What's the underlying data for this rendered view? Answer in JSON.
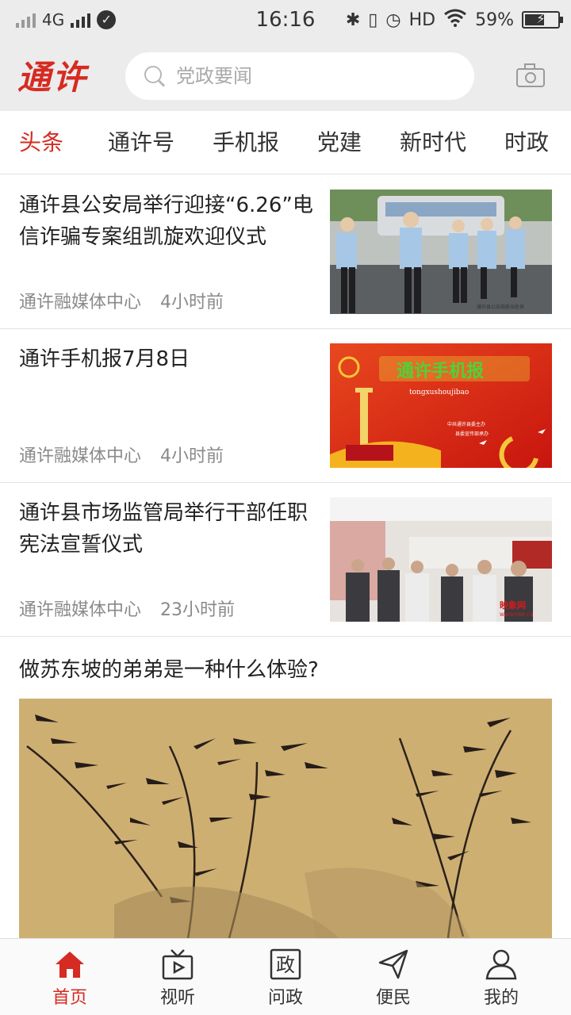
{
  "status_bar": {
    "network": "4G",
    "time": "16:16",
    "hd": "HD",
    "battery": "59%",
    "battery_level": 0.59
  },
  "header": {
    "logo": "通许",
    "search_placeholder": "党政要闻"
  },
  "tabs": [
    {
      "label": "头条",
      "active": true
    },
    {
      "label": "通许号",
      "active": false
    },
    {
      "label": "手机报",
      "active": false
    },
    {
      "label": "党建",
      "active": false
    },
    {
      "label": "新时代",
      "active": false
    },
    {
      "label": "时政",
      "active": false
    }
  ],
  "news": [
    {
      "title": "通许县公安局举行迎接“6.26”电信诈骗专案组凯旋欢迎仪式",
      "source": "通许融媒体中心",
      "time": "4小时前",
      "image_caption": "通许县公安局政治处供"
    },
    {
      "title": "通许手机报7月8日",
      "source": "通许融媒体中心",
      "time": "4小时前",
      "image_title": "通许手机报",
      "image_subtitle": "tongxushoujibao",
      "image_note_1": "中共通许县委主办",
      "image_note_2": "县委宣传部承办"
    },
    {
      "title": "通许县市场监管局举行干部任职宪法宣誓仪式",
      "source": "通许融媒体中心",
      "time": "23小时前",
      "image_watermark": "映象网",
      "image_watermark_url": "WWW.HNR.CN"
    }
  ],
  "feature": {
    "title": "做苏东坡的弟弟是一种什么体验?"
  },
  "bottom_nav": [
    {
      "label": "首页",
      "icon": "home-icon",
      "active": true
    },
    {
      "label": "视听",
      "icon": "tv-icon",
      "active": false
    },
    {
      "label": "问政",
      "icon": "zheng-icon",
      "glyph": "政",
      "active": false
    },
    {
      "label": "便民",
      "icon": "paper-plane-icon",
      "active": false
    },
    {
      "label": "我的",
      "icon": "user-icon",
      "active": false
    }
  ],
  "colors": {
    "accent": "#d62b22",
    "header_bg": "#ececec",
    "meta_text": "#8a8a8a"
  }
}
